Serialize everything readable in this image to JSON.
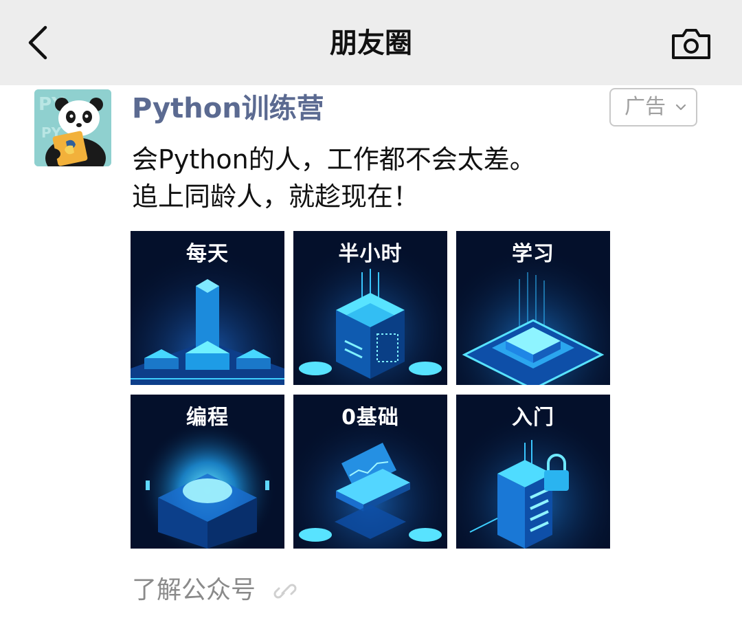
{
  "nav": {
    "title": "朋友圈",
    "back_icon": "chevron-left-icon",
    "camera_icon": "camera-icon"
  },
  "post": {
    "author": "Python训练营",
    "ad_label": "广告",
    "text_line_1": "会Python的人，工作都不会太差。",
    "text_line_2": "追上同龄人，就趁现在！",
    "images": [
      {
        "label": "每天"
      },
      {
        "label": "半小时"
      },
      {
        "label": "学习"
      },
      {
        "label": "编程"
      },
      {
        "label": "0基础"
      },
      {
        "label": "入门"
      }
    ],
    "footer_link": "了解公众号"
  },
  "colors": {
    "nav_bg": "#ededed",
    "author": "#5b6a91",
    "tile_bg": "#04102b",
    "glow": "#22c8ff"
  }
}
